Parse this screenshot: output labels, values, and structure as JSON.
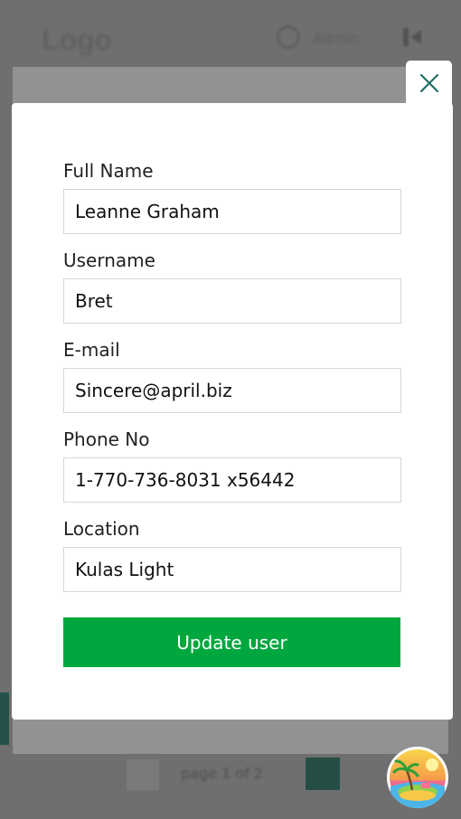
{
  "background": {
    "logo_text": "Logo",
    "user_name": "Admin",
    "pagination_label": "page 1 of 2"
  },
  "modal": {
    "close_icon": "close-icon",
    "fields": [
      {
        "label": "Full Name",
        "value": "Leanne Graham"
      },
      {
        "label": "Username",
        "value": "Bret"
      },
      {
        "label": "E-mail",
        "value": "Sincere@april.biz"
      },
      {
        "label": "Phone No",
        "value": "1-770-736-8031 x56442"
      },
      {
        "label": "Location",
        "value": "Kulas Light"
      }
    ],
    "submit_label": "Update user"
  },
  "colors": {
    "overlay": "#6f6f6f",
    "accent_green": "#00a73e",
    "close_icon": "#1f6f66",
    "dark_teal": "#254e47"
  },
  "badge": {
    "icon": "tropical-island-icon"
  }
}
